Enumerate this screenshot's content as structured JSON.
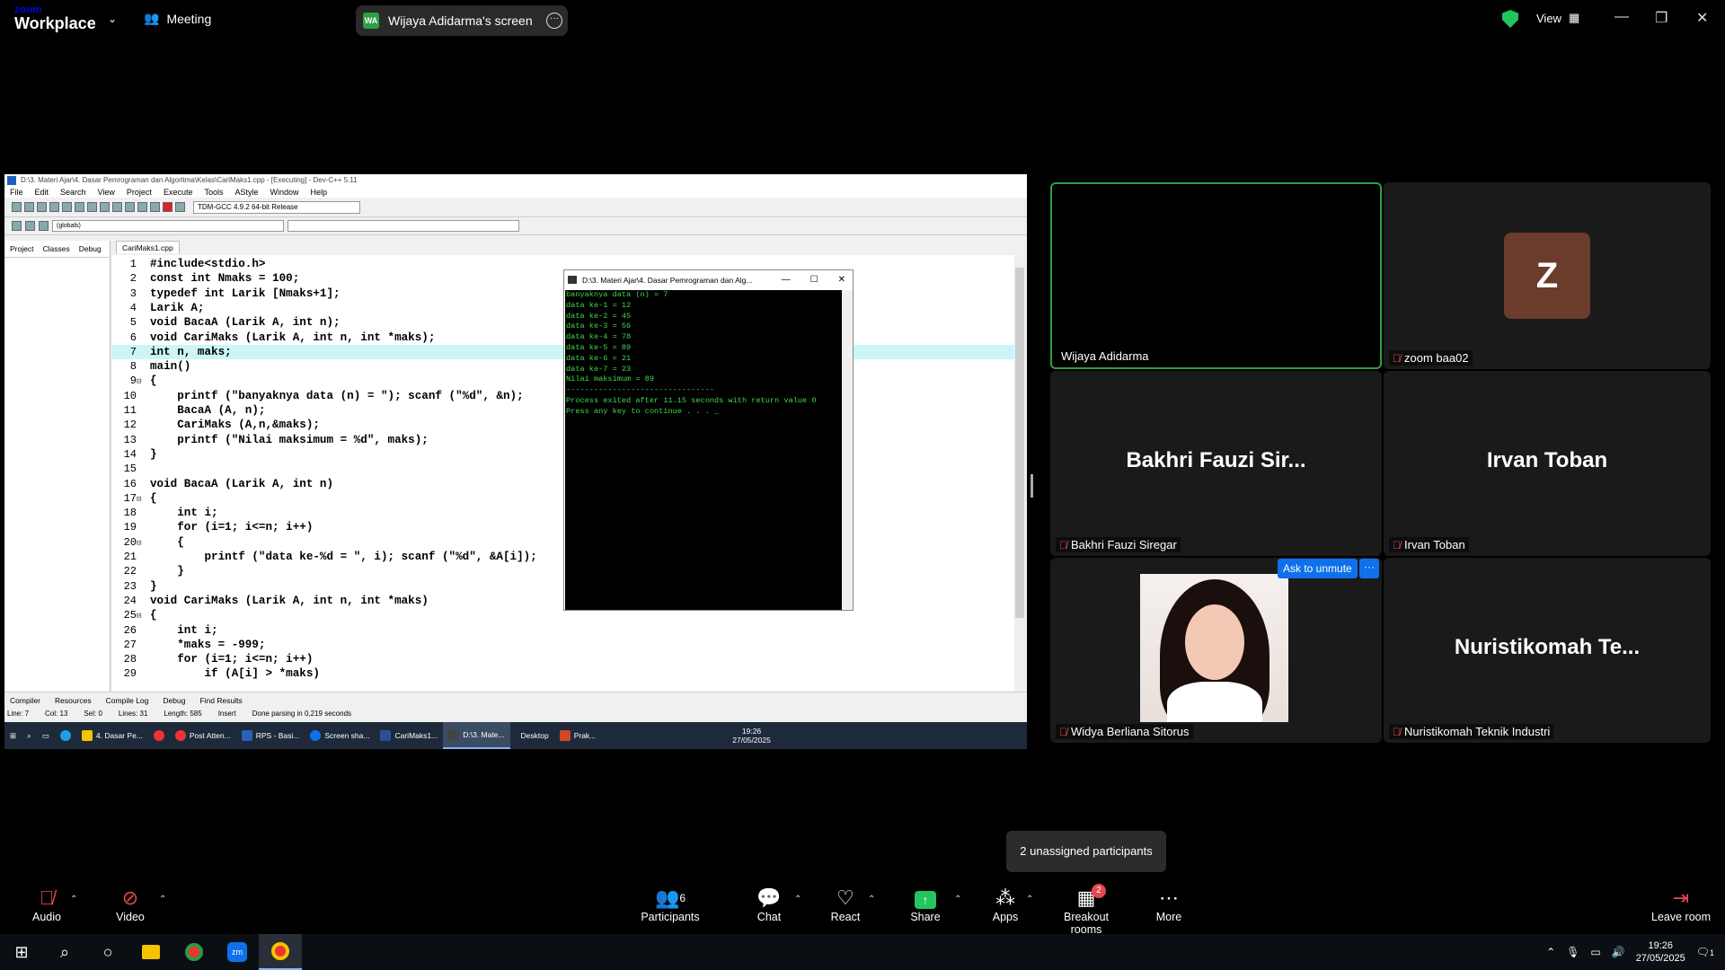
{
  "zoom": {
    "logo_small": "zoom",
    "logo_big": "Workplace",
    "meeting_label": "Meeting",
    "share_badge": "WA",
    "share_title": "Wijaya Adidarma's screen",
    "view_label": "View",
    "accent": "#0e71eb"
  },
  "devcpp": {
    "title": "D:\\3. Materi Ajar\\4. Dasar Pemrograman dan Algoritma\\Kelas\\CariMaks1.cpp - [Executing] - Dev-C++ 5.11",
    "menu": [
      "File",
      "Edit",
      "Search",
      "View",
      "Project",
      "Execute",
      "Tools",
      "AStyle",
      "Window",
      "Help"
    ],
    "compiler": "TDM-GCC 4.9.2 64-bit Release",
    "scope": "(globals)",
    "left_tabs": [
      "Project",
      "Classes",
      "Debug"
    ],
    "file_tab": "CariMaks1.cpp",
    "code": [
      {
        "n": "1",
        "f": "",
        "t": "#include<stdio.h>"
      },
      {
        "n": "2",
        "f": "",
        "t": "const int Nmaks = 100;"
      },
      {
        "n": "3",
        "f": "",
        "t": "typedef int Larik [Nmaks+1];"
      },
      {
        "n": "4",
        "f": "",
        "t": "Larik A;"
      },
      {
        "n": "5",
        "f": "",
        "t": "void BacaA (Larik A, int n);"
      },
      {
        "n": "6",
        "f": "",
        "t": "void CariMaks (Larik A, int n, int *maks);"
      },
      {
        "n": "7",
        "f": "",
        "t": "int n, maks;"
      },
      {
        "n": "8",
        "f": "",
        "t": "main()"
      },
      {
        "n": "9",
        "f": "⊟",
        "t": "{"
      },
      {
        "n": "10",
        "f": "",
        "t": "    printf (\"banyaknya data (n) = \"); scanf (\"%d\", &n);"
      },
      {
        "n": "11",
        "f": "",
        "t": "    BacaA (A, n);"
      },
      {
        "n": "12",
        "f": "",
        "t": "    CariMaks (A,n,&maks);"
      },
      {
        "n": "13",
        "f": "",
        "t": "    printf (\"Nilai maksimum = %d\", maks);"
      },
      {
        "n": "14",
        "f": "",
        "t": "}"
      },
      {
        "n": "15",
        "f": "",
        "t": ""
      },
      {
        "n": "16",
        "f": "",
        "t": "void BacaA (Larik A, int n)"
      },
      {
        "n": "17",
        "f": "⊟",
        "t": "{"
      },
      {
        "n": "18",
        "f": "",
        "t": "    int i;"
      },
      {
        "n": "19",
        "f": "",
        "t": "    for (i=1; i<=n; i++)"
      },
      {
        "n": "20",
        "f": "⊟",
        "t": "    {"
      },
      {
        "n": "21",
        "f": "",
        "t": "        printf (\"data ke-%d = \", i); scanf (\"%d\", &A[i]);"
      },
      {
        "n": "22",
        "f": "",
        "t": "    }"
      },
      {
        "n": "23",
        "f": "",
        "t": "}"
      },
      {
        "n": "24",
        "f": "",
        "t": "void CariMaks (Larik A, int n, int *maks)"
      },
      {
        "n": "25",
        "f": "⊟",
        "t": "{"
      },
      {
        "n": "26",
        "f": "",
        "t": "    int i;"
      },
      {
        "n": "27",
        "f": "",
        "t": "    *maks = -999;"
      },
      {
        "n": "28",
        "f": "",
        "t": "    for (i=1; i<=n; i++)"
      },
      {
        "n": "29",
        "f": "",
        "t": "        if (A[i] > *maks)"
      }
    ],
    "bottom_tabs": [
      "Compiler",
      "Resources",
      "Compile Log",
      "Debug",
      "Find Results"
    ],
    "status": [
      "Line:",
      "7",
      "Col:",
      "13",
      "Sel:",
      "0",
      "Lines:",
      "31",
      "Length:",
      "585",
      "Insert",
      "Done parsing in 0,219 seconds"
    ],
    "taskbar_items": [
      "4. Dasar Pe...",
      "Post Atten...",
      "RPS - Basi...",
      "Screen sha...",
      "CariMaks1...",
      "D:\\3. Mate...",
      "Desktop",
      "Prak..."
    ],
    "taskbar_time": "19:26",
    "taskbar_date": "27/05/2025"
  },
  "console": {
    "title": "D:\\3. Materi Ajar\\4. Dasar Pemrograman dan Alg...",
    "lines": [
      "banyaknya data (n) = 7",
      "data ke-1 = 12",
      "data ke-2 = 45",
      "data ke-3 = 56",
      "data ke-4 = 78",
      "data ke-5 = 89",
      "data ke-6 = 21",
      "data ke-7 = 23",
      "Nilai maksimum = 89",
      "--------------------------------",
      "Process exited after 11.15 seconds with return value 0",
      "Press any key to continue . . . _"
    ]
  },
  "gallery": {
    "p1": {
      "name": "Wijaya Adidarma"
    },
    "p2": {
      "name": "zoom baa02",
      "initial": "Z"
    },
    "p3": {
      "big": "Bakhri Fauzi Sir...",
      "name": "Bakhri Fauzi Siregar"
    },
    "p4": {
      "big": "Irvan Toban",
      "name": "Irvan Toban"
    },
    "p5": {
      "name": "Widya Berliana Sitorus"
    },
    "p6": {
      "big": "Nuristikomah Te...",
      "name": "Nuristikomah Teknik Industri"
    },
    "ask_unmute": "Ask to unmute",
    "more_dots": "···"
  },
  "tooltip": "2 unassigned participants",
  "toolbar": {
    "audio": "Audio",
    "video": "Video",
    "participants": "Participants",
    "participants_count": "6",
    "chat": "Chat",
    "react": "React",
    "share": "Share",
    "apps": "Apps",
    "breakout": "Breakout rooms",
    "breakout_badge": "2",
    "more": "More",
    "leave": "Leave room"
  },
  "host": {
    "time": "19:26",
    "date": "27/05/2025",
    "notif": "1"
  }
}
